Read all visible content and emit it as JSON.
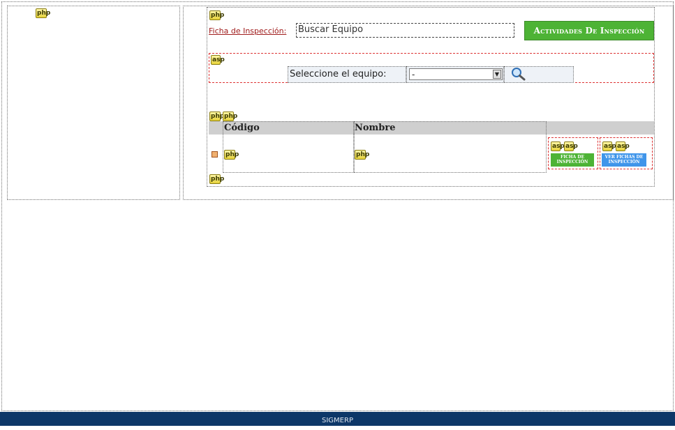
{
  "form": {
    "ficha_label": "Ficha de Inspección:",
    "search_value": "Buscar Equipo",
    "actividades_button": "Actividades De Inspección"
  },
  "selector": {
    "label": "Seleccione el equipo:",
    "selected_value": "-"
  },
  "grid": {
    "columns": [
      "Código",
      "Nombre"
    ]
  },
  "actions": {
    "ficha_button": "Ficha de Inspección",
    "ver_fichas_button": "Ver Fichas de Inspección"
  },
  "badges": {
    "php": "php",
    "asp": "asp"
  },
  "footer": {
    "text": "SIGMERP"
  },
  "colors": {
    "accent_green": "#4db335",
    "accent_blue": "#3f95ea",
    "link_red": "#a01c1c",
    "footer_navy": "#0d3768"
  },
  "icons": [
    "php-icon",
    "asp-icon",
    "magnifier-icon",
    "dropdown-arrow-icon",
    "row-marker-icon"
  ]
}
